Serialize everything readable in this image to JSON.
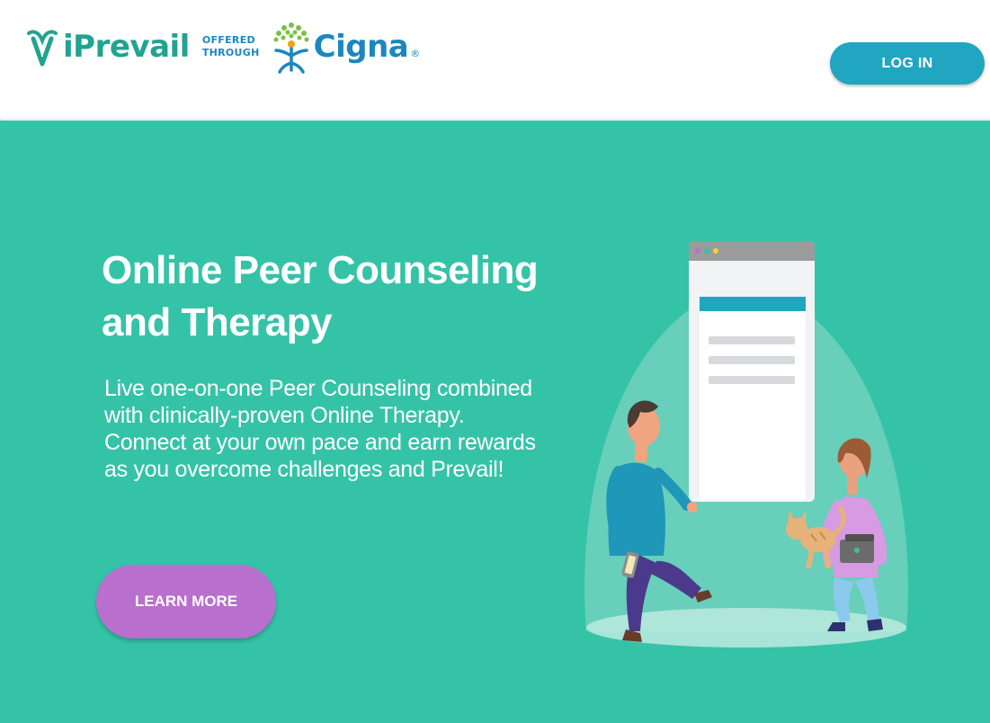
{
  "header": {
    "brand_name": "iPrevail",
    "offered_line1": "OFFERED",
    "offered_line2": "THROUGH",
    "partner_name": "Cigna",
    "partner_reg": "®",
    "login_label": "LOG IN"
  },
  "hero": {
    "title_line1": "Online Peer Counseling",
    "title_line2": "and Therapy",
    "description_line1": "Live one-on-one Peer Counseling combined",
    "description_line2": "with clinically-proven Online Therapy.",
    "description_line3": "Connect at your own pace and earn rewards",
    "description_line4": "as you overcome challenges and Prevail!",
    "cta_label": "LEARN MORE"
  },
  "colors": {
    "brand_green": "#21a391",
    "cigna_blue": "#1c87bf",
    "hero_bg": "#35c3a8",
    "login_bg": "#20a6c0",
    "cta_bg": "#b96fce"
  },
  "icons": {
    "brand_logo": "iprevail-leaf-icon",
    "partner_logo": "cigna-tree-icon"
  }
}
